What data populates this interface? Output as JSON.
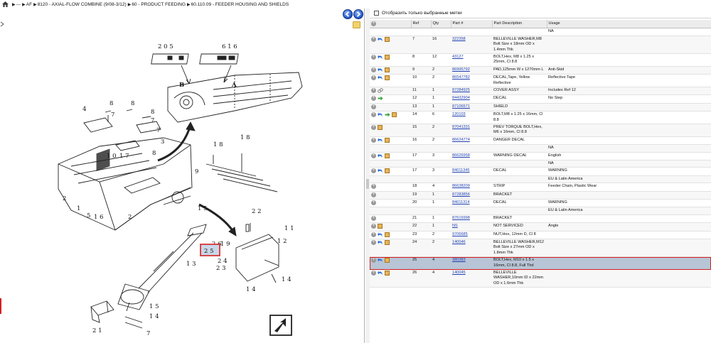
{
  "breadcrumb": [
    "---",
    "AF",
    "8120 - AXIAL-FLOW COMBINE (9/08-3/12)",
    "60 - PRODUCT FEEDING",
    "60.110.09 - FEEDER HOUSING AND SHIELDS"
  ],
  "filter": {
    "label": "Отобразить только выбранные метки"
  },
  "table": {
    "headers": [
      "",
      "Ref",
      "Qty",
      "Part #",
      "Part Description",
      "Usage"
    ],
    "rows": [
      {
        "icons": [],
        "ref": "",
        "qty": "",
        "part": "",
        "desc": "",
        "usage": "NA"
      },
      {
        "icons": [
          "plus",
          "undo",
          "box"
        ],
        "ref": "7",
        "qty": "16",
        "part": "322358",
        "desc": "BELLEVILLE WASHER,M8 Bolt Size x 18mm OD x 1.4mm Thk",
        "usage": ""
      },
      {
        "icons": [
          "plus",
          "undo",
          "box"
        ],
        "ref": "8",
        "qty": "12",
        "part": "43127",
        "desc": "BOLT,Hex, M8 x 1.25 x 25mm, Cl 8.8",
        "usage": ""
      },
      {
        "icons": [
          "plus",
          "undo",
          "box"
        ],
        "ref": "9",
        "qty": "2",
        "part": "86995792",
        "desc": "PAD,125mm W x 1270mm L",
        "usage": "Anti-Skid"
      },
      {
        "icons": [
          "plus",
          "undo",
          "box"
        ],
        "ref": "10",
        "qty": "2",
        "part": "86547782",
        "desc": "DECAL,Tape, Yellow Reflective",
        "usage": "Reflective Tape"
      },
      {
        "icons": [
          "plus",
          "link"
        ],
        "ref": "11",
        "qty": "1",
        "part": "87284925",
        "desc": "COVER ASSY",
        "usage": "Includes Ref 12"
      },
      {
        "icons": [
          "plus",
          "green"
        ],
        "ref": "12",
        "qty": "1",
        "part": "84432904",
        "desc": "DECAL",
        "usage": "No Step"
      },
      {
        "icons": [
          "plus"
        ],
        "ref": "13",
        "qty": "1",
        "part": "87106571",
        "desc": "SHIELD",
        "usage": ""
      },
      {
        "icons": [
          "plus",
          "undo",
          "green",
          "box"
        ],
        "ref": "14",
        "qty": "6",
        "part": "120103",
        "desc": "BOLT,M8 x 1.25 x 16mm, Cl 8.8",
        "usage": ""
      },
      {
        "icons": [
          "plus",
          "box"
        ],
        "ref": "15",
        "qty": "2",
        "part": "87041331",
        "desc": "PREV TORQUE BOLT,Hex, M6 x 16mm, Cl 8.8",
        "usage": ""
      },
      {
        "icons": [
          "plus",
          "undo",
          "box"
        ],
        "ref": "16",
        "qty": "2",
        "part": "86624774",
        "desc": "DANGER DECAL",
        "usage": ""
      },
      {
        "icons": [],
        "ref": "",
        "qty": "",
        "part": "",
        "desc": "",
        "usage": "NA"
      },
      {
        "icons": [
          "plus",
          "undo",
          "box"
        ],
        "ref": "17",
        "qty": "3",
        "part": "86626958",
        "desc": "WARNING DECAL",
        "usage": "English"
      },
      {
        "icons": [],
        "ref": "",
        "qty": "",
        "part": "",
        "desc": "",
        "usage": "NA"
      },
      {
        "icons": [
          "plus",
          "undo",
          "box"
        ],
        "ref": "17",
        "qty": "3",
        "part": "84011345",
        "desc": "DECAL",
        "usage": "WARNING"
      },
      {
        "icons": [],
        "ref": "",
        "qty": "",
        "part": "",
        "desc": "",
        "usage": "EU & Latin America"
      },
      {
        "icons": [
          "plus"
        ],
        "ref": "18",
        "qty": "4",
        "part": "86638209",
        "desc": "STRIP",
        "usage": "Feeder Chain, Plastic Wear"
      },
      {
        "icons": [
          "plus"
        ],
        "ref": "19",
        "qty": "1",
        "part": "87283856",
        "desc": "BRACKET",
        "usage": ""
      },
      {
        "icons": [
          "plus"
        ],
        "ref": "20",
        "qty": "1",
        "part": "84011314",
        "desc": "DECAL",
        "usage": "WARNING"
      },
      {
        "icons": [],
        "ref": "",
        "qty": "",
        "part": "",
        "desc": "",
        "usage": "EU & Latin America"
      },
      {
        "icons": [
          "plus"
        ],
        "ref": "21",
        "qty": "1",
        "part": "87616998",
        "desc": "BRACKET",
        "usage": ""
      },
      {
        "icons": [
          "plus",
          "box"
        ],
        "ref": "22",
        "qty": "1",
        "part": "NS",
        "desc": "NOT SERVICED",
        "usage": "Angle"
      },
      {
        "icons": [
          "plus",
          "undo",
          "box"
        ],
        "ref": "23",
        "qty": "2",
        "part": "9706685",
        "desc": "NUT,Hex, 12mm D, Cl 8",
        "usage": ""
      },
      {
        "icons": [
          "plus",
          "undo",
          "box"
        ],
        "ref": "24",
        "qty": "2",
        "part": "140046",
        "desc": "BELLEVILLE WASHER,M12 Bolt Size x 27mm OD x 1.8mm Thk",
        "usage": ""
      },
      {
        "icons": [
          "plus",
          "undo",
          "box"
        ],
        "ref": "25",
        "qty": "4",
        "part": "380383",
        "desc": "BOLT,Hex, M10 x 1.5 x 16mm, Cl 8.8, Full Thd",
        "usage": "",
        "selected": true
      },
      {
        "icons": [
          "plus",
          "undo",
          "box"
        ],
        "ref": "26",
        "qty": "4",
        "part": "140045",
        "desc": "BELLEVILLE WASHER,10mm ID x 22mm OD x 1.6mm Thk",
        "usage": ""
      }
    ]
  },
  "diagram": {
    "labels": {
      "top_left_refs": "2 0  5",
      "top_right_refs": "6  1 6",
      "view_b": "B",
      "view_a": "A",
      "r4": "4",
      "r8": "8",
      "r7": "7",
      "r3": "3",
      "r17": "1 7",
      "r10": "1 0",
      "r9": "9",
      "r2": "2",
      "r1": "1",
      "r5": "5",
      "r16": "1 6",
      "r18a": "1 8",
      "r18b": "1 8",
      "r22": "2 2",
      "r11": "1 1",
      "r12": "1 2",
      "r15a": "1 5",
      "r19": "1 9",
      "r26": "2 6",
      "r25": "2 5",
      "r24": "2 4",
      "r23": "2 3",
      "r13": "1 3",
      "r14a": "1 4",
      "r14b": "1 4",
      "r15b": "1 5",
      "r21": "2 1",
      "r14c": "1 4",
      "r7b": "7"
    }
  }
}
